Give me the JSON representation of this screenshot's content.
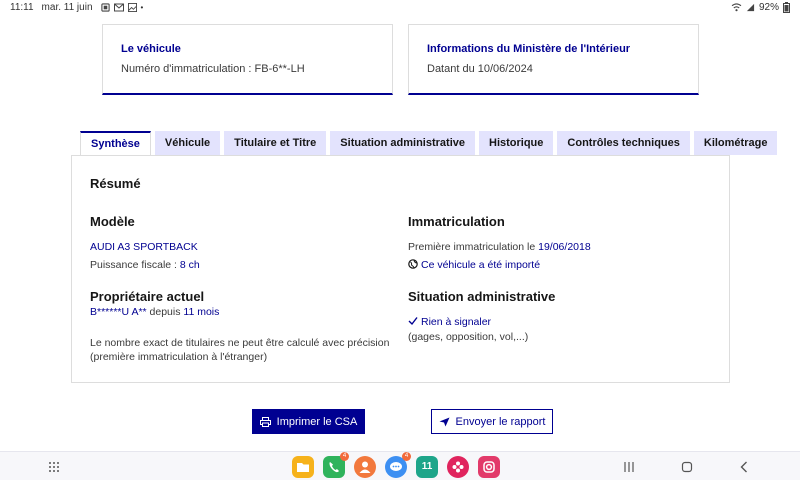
{
  "status_bar": {
    "time": "11:11",
    "date": "mar. 11 juin",
    "battery": "92%"
  },
  "vehicle_card": {
    "title": "Le véhicule",
    "registration": "Numéro d'immatriculation : FB-6**-LH"
  },
  "ministry_card": {
    "title": "Informations du Ministère de l'Intérieur",
    "date_text": "Datant du 10/06/2024"
  },
  "tabs": [
    {
      "label": "Synthèse",
      "active": true
    },
    {
      "label": "Véhicule",
      "active": false
    },
    {
      "label": "Titulaire et Titre",
      "active": false
    },
    {
      "label": "Situation administrative",
      "active": false
    },
    {
      "label": "Historique",
      "active": false
    },
    {
      "label": "Contrôles techniques",
      "active": false
    },
    {
      "label": "Kilométrage",
      "active": false
    }
  ],
  "summary": {
    "title": "Résumé",
    "model": {
      "heading": "Modèle",
      "name": "AUDI A3 SPORTBACK",
      "power_label": "Puissance fiscale : ",
      "power_value": "8 ch"
    },
    "owner": {
      "heading": "Propriétaire actuel",
      "name": "B******U A**",
      "since_label": " depuis ",
      "since_value": "11 mois",
      "note_line1": "Le nombre exact de titulaires ne peut être calculé avec précision",
      "note_line2": "(première immatriculation à l'étranger)"
    },
    "registration": {
      "heading": "Immatriculation",
      "first_label": "Première immatriculation le ",
      "first_date": "19/06/2018",
      "imported_text": "Ce véhicule a été importé"
    },
    "admin_situation": {
      "heading": "Situation administrative",
      "status": "Rien à signaler",
      "detail": "(gages, opposition, vol,...)"
    }
  },
  "actions": {
    "print_label": "Imprimer le CSA",
    "send_label": "Envoyer le rapport"
  },
  "dock": {
    "badges": {
      "phone": "4",
      "messages": "4"
    },
    "calendar_day": "11"
  },
  "colors": {
    "primary": "#000091",
    "tab_bg": "#e3e3fd"
  }
}
